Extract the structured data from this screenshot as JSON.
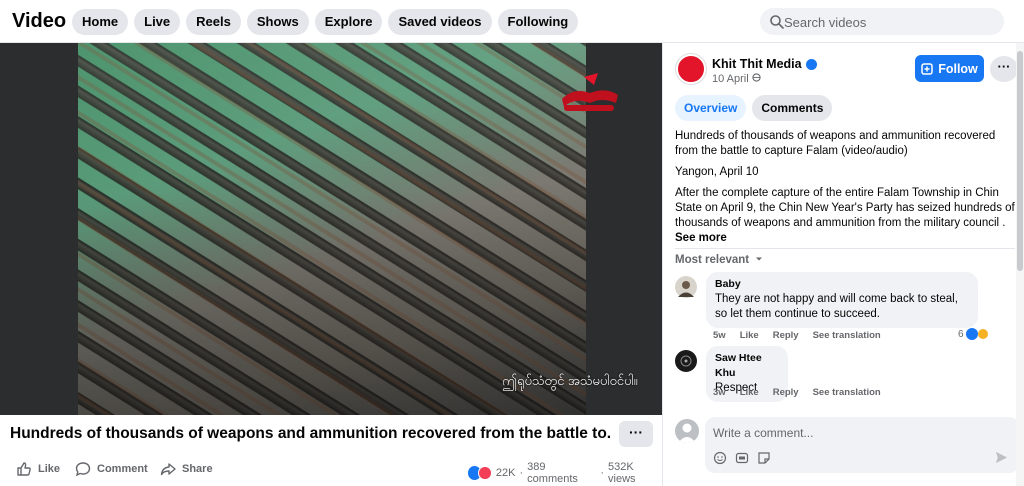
{
  "header": {
    "title": "Video",
    "nav": [
      "Home",
      "Live",
      "Reels",
      "Shows",
      "Explore",
      "Saved videos",
      "Following"
    ],
    "search_placeholder": "Search videos"
  },
  "video": {
    "watermark_caption": "ဤရုပ်သံတွင် အသံမပါဝင်ပါ။",
    "title": "Hundreds of thousands of weapons and ammunition recovered from the battle to...",
    "more_label": "···"
  },
  "actions": {
    "like": "Like",
    "comment": "Comment",
    "share": "Share",
    "reactions_count": "22K",
    "comments_count": "389 comments",
    "views_count": "532K views",
    "sep": "·"
  },
  "post": {
    "page_name": "Khit Thit Media",
    "date": "10 April",
    "follow_label": "Follow",
    "more_label": "···",
    "tabs": [
      "Overview",
      "Comments"
    ],
    "description": {
      "line1": "Hundreds of thousands of weapons and ammunition recovered from the battle to capture Falam (video/audio)",
      "line2": "Yangon, April 10",
      "line3": "After the complete capture of the entire Falam Township in Chin State on April 9, the Chin New Year's Party has seized hundreds of thousands of weapons and ammunition from the military council .",
      "see_more": "See more"
    }
  },
  "comments": {
    "sort_label": "Most relevant",
    "items": [
      {
        "name": "Baby",
        "text": "They are not happy and will come back to steal, so let them continue to succeed.",
        "age": "5w",
        "like": "Like",
        "reply": "Reply",
        "translate": "See translation",
        "reactions": "6"
      },
      {
        "name": "Saw Htee Khu",
        "text": "Respect",
        "age": "3w",
        "like": "Like",
        "reply": "Reply",
        "translate": "See translation",
        "reactions": ""
      }
    ],
    "write_placeholder": "Write a comment..."
  },
  "colors": {
    "accent": "#1877f2",
    "love": "#f33e58",
    "page_avatar": "#e3152b"
  }
}
